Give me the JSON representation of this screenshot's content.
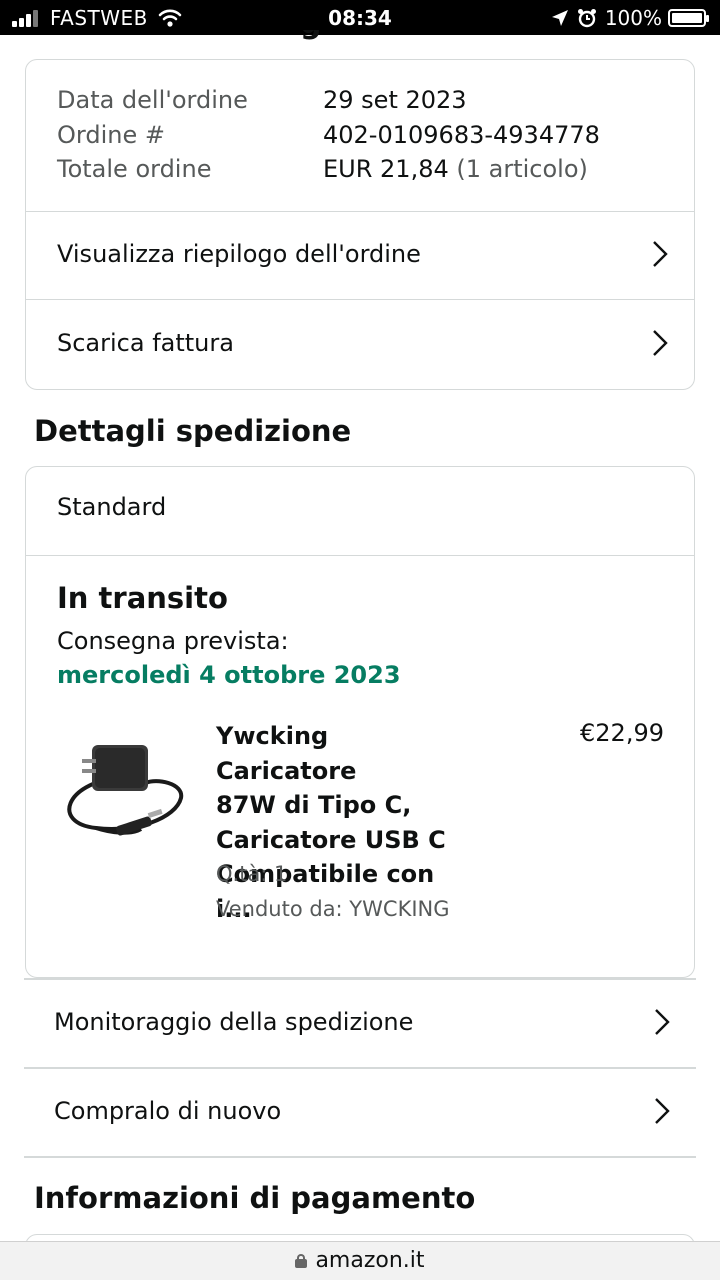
{
  "status_bar": {
    "carrier": "FASTWEB",
    "time": "08:34",
    "battery": "100%"
  },
  "order": {
    "date_label": "Data dell'ordine",
    "date_value": "29 set 2023",
    "number_label": "Ordine #",
    "number_value": "402-0109683-4934778",
    "total_label": "Totale ordine",
    "total_value": "EUR 21,84",
    "total_items": "(1 articolo)",
    "summary_link": "Visualizza riepilogo dell'ordine",
    "invoice_link": "Scarica fattura"
  },
  "shipping": {
    "section_title": "Dettagli spedizione",
    "method": "Standard",
    "status": "In transito",
    "expected_label": "Consegna prevista:",
    "expected_date": "mercoledì 4 ottobre 2023",
    "status_color": "#067d62",
    "product": {
      "title_lines": [
        "Ywcking Caricatore",
        "87W di Tipo C,",
        "Caricatore USB C",
        "Compatibile con i..."
      ],
      "price": "€22,99",
      "qty": "Q.tà: 1",
      "seller": "Venduto da: YWCKING",
      "image_icon": "laptop-charger-image"
    },
    "track_link": "Monitoraggio della spedizione",
    "buy_again_link": "Compralo di nuovo"
  },
  "payment": {
    "section_title": "Informazioni di pagamento"
  },
  "browser": {
    "url": "amazon.it"
  }
}
